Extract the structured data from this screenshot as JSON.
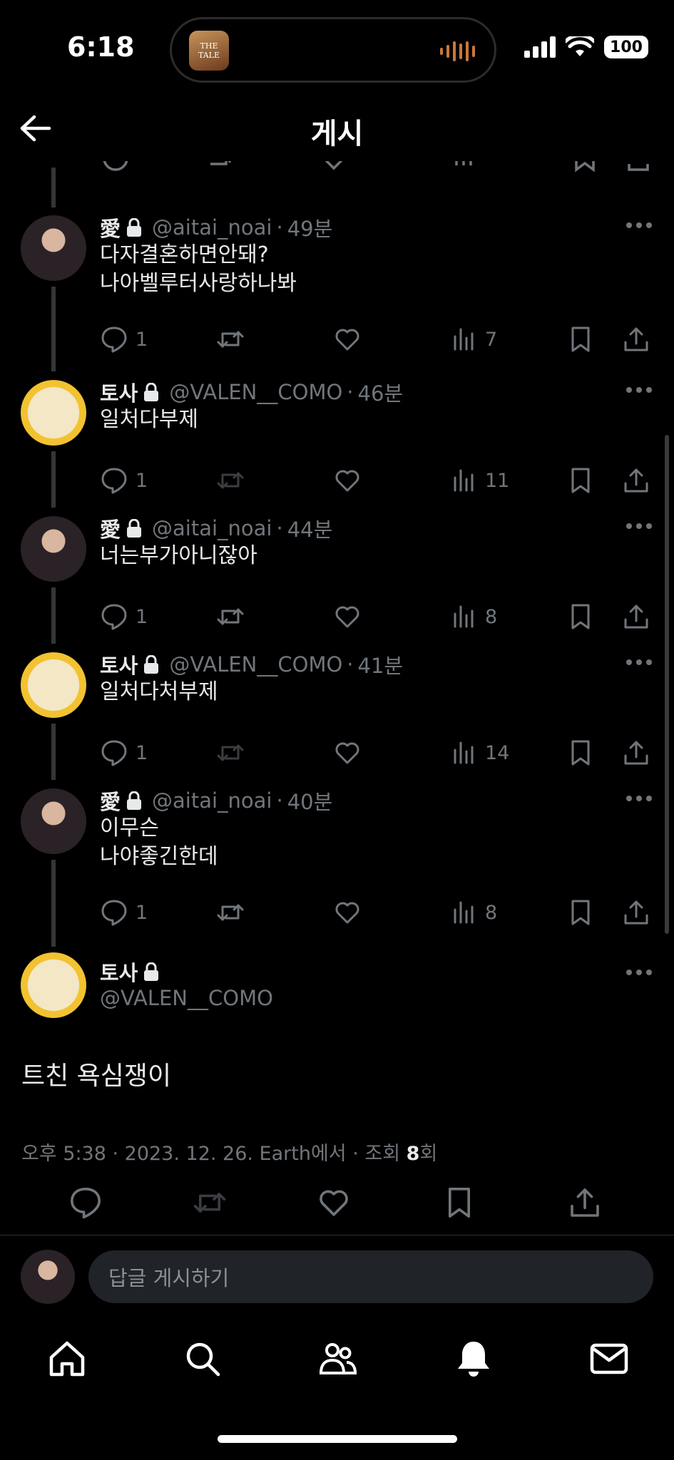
{
  "status": {
    "time": "6:18",
    "battery": "100",
    "island_app": "THE TALE"
  },
  "header": {
    "title": "게시"
  },
  "tweets": [
    {
      "name": "愛",
      "handle": "@aitai_noai",
      "time": "49분",
      "text": "다자결혼하면안돼?\n나아벨루터사랑하나봐",
      "replies": "1",
      "views": "7"
    },
    {
      "name": "토사",
      "handle": "@VALEN__COMO",
      "time": "46분",
      "text": "일처다부제",
      "replies": "1",
      "views": "11"
    },
    {
      "name": "愛",
      "handle": "@aitai_noai",
      "time": "44분",
      "text": "너는부가아니잖아",
      "replies": "1",
      "views": "8"
    },
    {
      "name": "토사",
      "handle": "@VALEN__COMO",
      "time": "41분",
      "text": "일처다처부제",
      "replies": "1",
      "views": "14"
    },
    {
      "name": "愛",
      "handle": "@aitai_noai",
      "time": "40분",
      "text": "이무슨\n나야좋긴한데",
      "replies": "1",
      "views": "8"
    }
  ],
  "main_tweet": {
    "name": "토사",
    "handle": "@VALEN__COMO",
    "text": "트친 욕심쟁이",
    "meta_prefix": "오후 5:38 · 2023. 12. 26. Earth에서 · 조회 ",
    "views": "8",
    "meta_suffix": "회"
  },
  "reply": {
    "placeholder": "답글 게시하기"
  },
  "colors": {
    "background": "#000000",
    "text": "#e7e9ea",
    "muted": "#71767b",
    "divider": "#2f3336"
  }
}
